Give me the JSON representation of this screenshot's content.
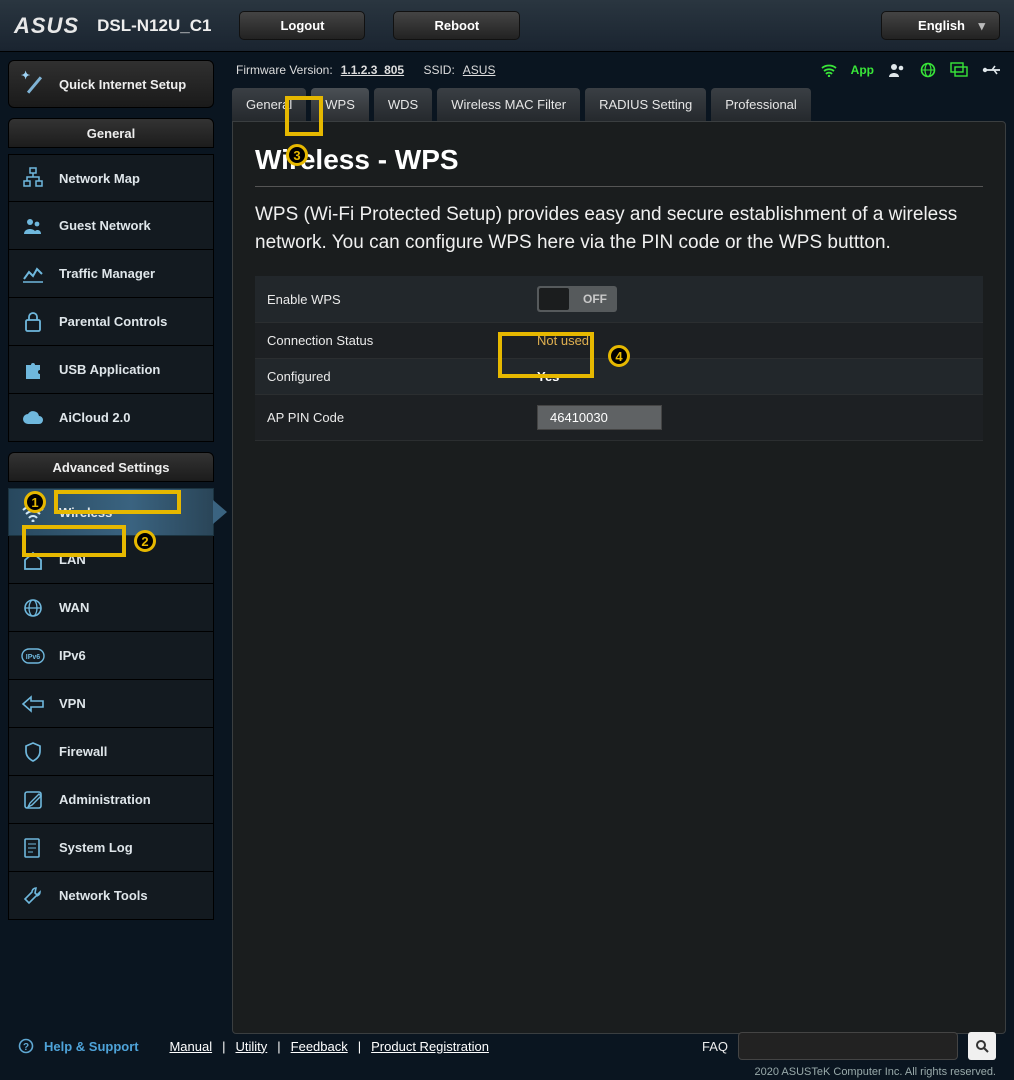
{
  "brand": "ASUS",
  "model": "DSL-N12U_C1",
  "buttons": {
    "logout": "Logout",
    "reboot": "Reboot",
    "language": "English"
  },
  "meta": {
    "fw_label": "Firmware Version:",
    "fw_value": "1.1.2.3_805",
    "ssid_label": "SSID:",
    "ssid_value": "ASUS",
    "app": "App"
  },
  "sidebar": {
    "quick": "Quick Internet Setup",
    "general_head": "General",
    "general": [
      "Network Map",
      "Guest Network",
      "Traffic Manager",
      "Parental Controls",
      "USB Application",
      "AiCloud 2.0"
    ],
    "advanced_head": "Advanced Settings",
    "advanced": [
      "Wireless",
      "LAN",
      "WAN",
      "IPv6",
      "VPN",
      "Firewall",
      "Administration",
      "System Log",
      "Network Tools"
    ]
  },
  "tabs": [
    "General",
    "WPS",
    "WDS",
    "Wireless MAC Filter",
    "RADIUS Setting",
    "Professional"
  ],
  "active_tab": 1,
  "page": {
    "title": "Wireless - WPS",
    "desc": "WPS (Wi-Fi Protected Setup) provides easy and secure establishment of a wireless network. You can configure WPS here via the PIN code or the WPS buttton.",
    "rows": {
      "enable_label": "Enable WPS",
      "enable_state": "OFF",
      "conn_label": "Connection Status",
      "conn_value": "Not used",
      "conf_label": "Configured",
      "conf_value": "Yes",
      "pin_label": "AP PIN Code",
      "pin_value": "46410030"
    }
  },
  "callouts": {
    "1": "1",
    "2": "2",
    "3": "3",
    "4": "4"
  },
  "footer": {
    "help": "Help & Support",
    "links": [
      "Manual",
      "Utility",
      "Feedback",
      "Product Registration"
    ],
    "faq": "FAQ",
    "copyright": "2020 ASUSTeK Computer Inc. All rights reserved."
  }
}
